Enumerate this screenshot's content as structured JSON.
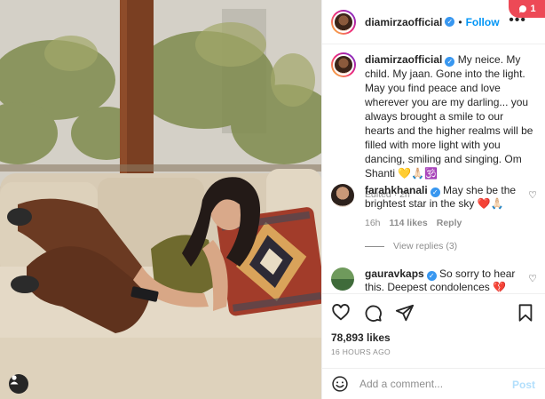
{
  "notification": {
    "count": "1"
  },
  "header": {
    "username": "diamirzaofficial",
    "separator": "•",
    "follow_label": "Follow",
    "more_label": "•••"
  },
  "caption": {
    "username": "diamirzaofficial",
    "text": "My neice. My child. My jaan. Gone into the light. May you find peace and love wherever you are my darling... you always brought a smile to our hearts and the higher realms will be filled with more light with you dancing, smiling and singing. Om Shanti 💛🙏🏻🕉️",
    "meta": "Edited · 2h"
  },
  "comments": [
    {
      "username": "farahkhanali",
      "text": "May she be the brightest star in the sky ❤️🙏🏻",
      "time": "16h",
      "likes": "114 likes",
      "reply_label": "Reply",
      "view_replies": "View replies (3)"
    },
    {
      "username": "gauravkaps",
      "text": "So sorry to hear this. Deepest condolences 💔"
    }
  ],
  "post": {
    "likes": "78,893 likes",
    "timestamp": "16 HOURS AGO"
  },
  "add_comment": {
    "placeholder": "Add a comment...",
    "post_label": "Post"
  },
  "icons": {
    "like": "heart-icon",
    "comment": "comment-icon",
    "share": "share-icon",
    "save": "bookmark-icon",
    "emoji": "emoji-icon",
    "user_tag": "user-tag-icon",
    "verified": "verified-badge-icon"
  },
  "colors": {
    "follow": "#0095f6",
    "verified": "#3897f0",
    "notification": "#ed4956",
    "secondary_text": "#8e8e8e",
    "post_disabled": "#b2dffc"
  }
}
